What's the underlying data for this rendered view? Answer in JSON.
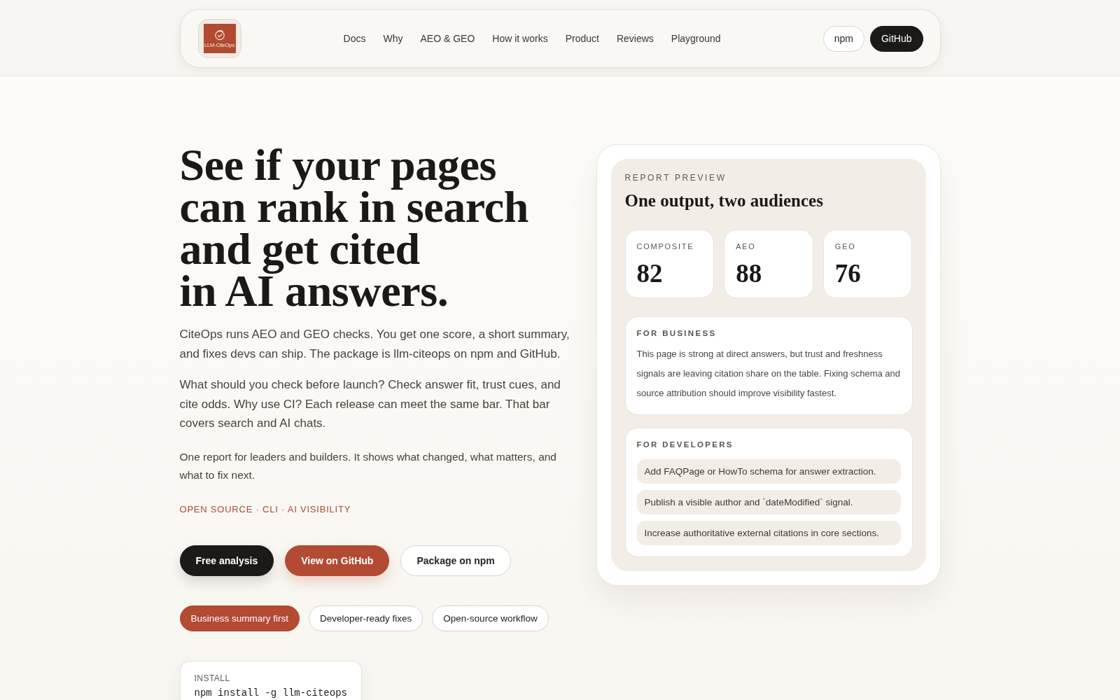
{
  "header": {
    "logo": {
      "text": "LLM-CiteOps"
    },
    "nav": [
      "Docs",
      "Why",
      "AEO & GEO",
      "How it works",
      "Product",
      "Reviews",
      "Playground"
    ],
    "actions": [
      {
        "label": "npm",
        "kind": "outline"
      },
      {
        "label": "GitHub",
        "kind": "dark"
      }
    ]
  },
  "hero": {
    "heading_lines": [
      "See if your pages",
      "can rank in search",
      "and get cited",
      "in AI answers."
    ],
    "paragraphs": [
      {
        "kind": "lead",
        "text": "CiteOps runs AEO and GEO checks. You get one score, a short summary, and fixes devs can ship. The package is llm-citeops on npm and GitHub."
      },
      {
        "kind": "lead",
        "text": "What should you check before launch? Check answer fit, trust cues, and cite odds. Why use CI? Each release can meet the same bar. That bar covers search and AI chats."
      },
      {
        "kind": "small",
        "text": "One report for leaders and builders. It shows what changed, what matters, and what to fix next."
      }
    ],
    "tagline": "OPEN SOURCE · CLI · AI VISIBILITY",
    "buttons": [
      {
        "label": "Free analysis",
        "kind": "dark"
      },
      {
        "label": "View on GitHub",
        "kind": "accent"
      },
      {
        "label": "Package on npm",
        "kind": "outline"
      }
    ],
    "chips": [
      {
        "label": "Business summary first",
        "selected": true
      },
      {
        "label": "Developer-ready fixes",
        "selected": false
      },
      {
        "label": "Open-source workflow",
        "selected": false
      }
    ],
    "install": {
      "label": "INSTALL",
      "command": "npm install -g llm-citeops"
    }
  },
  "report": {
    "eyebrow": "REPORT PREVIEW",
    "title": "One output, two audiences",
    "scores": [
      {
        "label": "COMPOSITE",
        "value": "82"
      },
      {
        "label": "AEO",
        "value": "88"
      },
      {
        "label": "GEO",
        "value": "76"
      }
    ],
    "business": {
      "label": "FOR BUSINESS",
      "text": "This page is strong at direct answers, but trust and freshness signals are leaving citation share on the table. Fixing schema and source attribution should improve visibility fastest."
    },
    "developers": {
      "label": "FOR DEVELOPERS",
      "items": [
        "Add FAQPage or HowTo schema for answer extraction.",
        "Publish a visible author and `dateModified` signal.",
        "Increase authoritative external citations in core sections."
      ]
    }
  }
}
